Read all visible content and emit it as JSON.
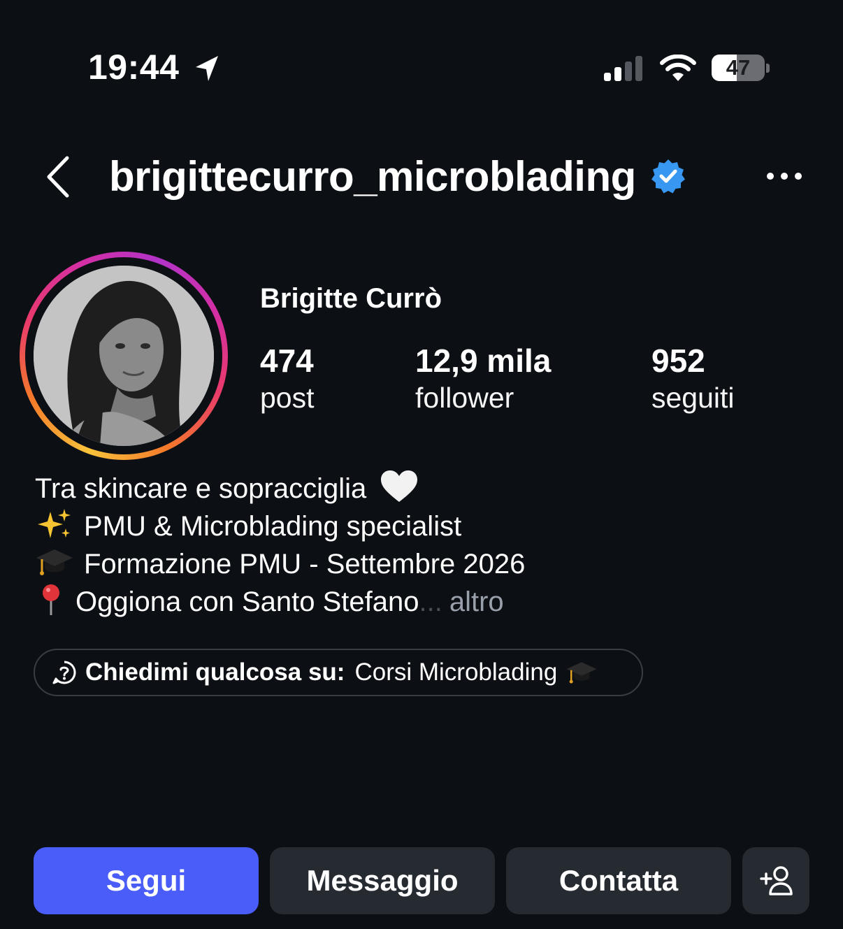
{
  "status_bar": {
    "time": "19:44",
    "battery": "47",
    "battery_level": 0.47,
    "icons": [
      "location-arrow-icon",
      "cellular-signal-icon",
      "wifi-icon",
      "battery-icon"
    ]
  },
  "header": {
    "username": "brigittecurro_microblading",
    "verified": true,
    "icons": [
      "back-chevron-icon",
      "verified-badge-icon",
      "more-options-icon"
    ]
  },
  "profile": {
    "name": "Brigitte Currò",
    "stats": [
      {
        "value": "474",
        "label": "post"
      },
      {
        "value": "12,9 mila",
        "label": "follower"
      },
      {
        "value": "952",
        "label": "seguiti"
      }
    ]
  },
  "bio": {
    "line1": "Tra skincare e sopracciglia",
    "line2": "PMU & Microblading specialist",
    "line3": "Formazione PMU - Settembre 2026",
    "line4": "Oggiona con Santo Stefano",
    "ellipsis": "...",
    "more": "altro",
    "emojis": [
      "white-heart-emoji",
      "sparkles-emoji",
      "graduation-cap-emoji",
      "round-pushpin-emoji"
    ]
  },
  "ask": {
    "label": "Chiedimi qualcosa su:",
    "topic": "Corsi Microblading"
  },
  "actions": {
    "follow": "Segui",
    "message": "Messaggio",
    "contact": "Contatta"
  },
  "colors": {
    "background": "#0c0f14",
    "follow_button": "#4a5df9",
    "secondary_button": "#262a31",
    "verified_blue": "#3897f0"
  }
}
